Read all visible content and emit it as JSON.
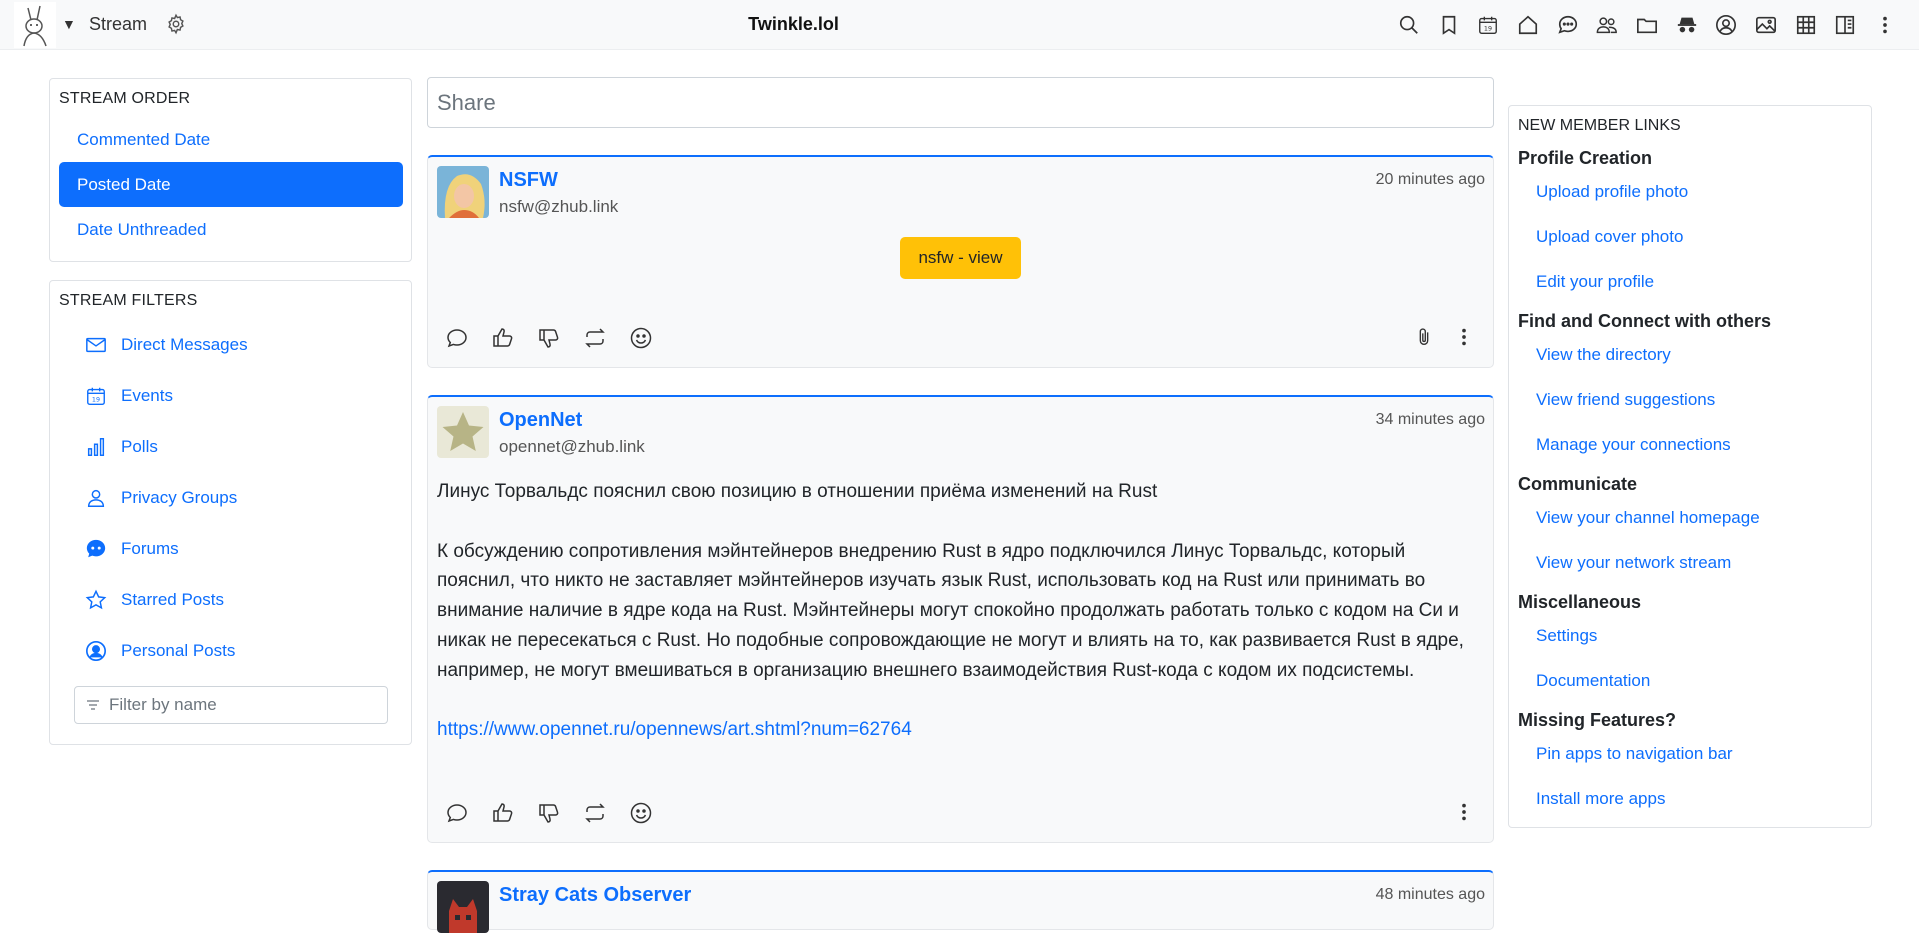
{
  "topbar": {
    "app_name": "Stream",
    "site_title": "Twinkle.lol",
    "icons": [
      "search-icon",
      "bookmark-icon",
      "calendar-icon",
      "home-icon",
      "chat-icon",
      "people-icon",
      "folder-icon",
      "incognito-icon",
      "profile-icon",
      "image-icon",
      "grid-icon",
      "book-icon",
      "more-vertical-icon"
    ]
  },
  "stream_order": {
    "title": "STREAM ORDER",
    "items": [
      {
        "label": "Commented Date",
        "active": false
      },
      {
        "label": "Posted Date",
        "active": true
      },
      {
        "label": "Date Unthreaded",
        "active": false
      }
    ]
  },
  "stream_filters": {
    "title": "STREAM FILTERS",
    "items": [
      {
        "label": "Direct Messages",
        "icon": "envelope-icon"
      },
      {
        "label": "Events",
        "icon": "calendar-icon"
      },
      {
        "label": "Polls",
        "icon": "bar-chart-icon"
      },
      {
        "label": "Privacy Groups",
        "icon": "person-icon"
      },
      {
        "label": "Forums",
        "icon": "forum-icon"
      },
      {
        "label": "Starred Posts",
        "icon": "star-icon"
      },
      {
        "label": "Personal Posts",
        "icon": "person-circle-icon"
      }
    ],
    "filter_placeholder": "Filter by name"
  },
  "share": {
    "placeholder": "Share"
  },
  "posts": [
    {
      "author": "NSFW",
      "handle": "nsfw@zhub.link",
      "time": "20 minutes ago",
      "nsfw_button": "nsfw - view"
    },
    {
      "author": "OpenNet",
      "handle": "opennet@zhub.link",
      "time": "34 minutes ago",
      "title": "Линус Торвальдс пояснил свою позицию в отношении приёма изменений на Rust",
      "body": "К обсуждению сопротивления мэйнтейнеров внедрению Rust в ядро подключился Линус Торвальдс, который пояснил, что никто не заставляет мэйнтейнеров изучать язык Rust, использовать код на Rust или принимать во внимание наличие в ядре кода на Rust. Мэйнтейнеры могут спокойно продолжать работать только с кодом на Си и никак не пересекаться с Rust. Но подобные сопровождающие не могут и влиять на то, как развивается Rust в ядре, например, не могут вмешиваться в организацию внешнего взаимодействия Rust-кода с кодом их подсистемы.",
      "link": "https://www.opennet.ru/opennews/art.shtml?num=62764"
    },
    {
      "author": "Stray Cats Observer",
      "time": "48 minutes ago"
    }
  ],
  "new_member": {
    "title": "NEW MEMBER LINKS",
    "sections": [
      {
        "heading": "Profile Creation",
        "links": [
          "Upload profile photo",
          "Upload cover photo",
          "Edit your profile"
        ]
      },
      {
        "heading": "Find and Connect with others",
        "links": [
          "View the directory",
          "View friend suggestions",
          "Manage your connections"
        ]
      },
      {
        "heading": "Communicate",
        "links": [
          "View your channel homepage",
          "View your network stream"
        ]
      },
      {
        "heading": "Miscellaneous",
        "links": [
          "Settings",
          "Documentation"
        ]
      },
      {
        "heading": "Missing Features?",
        "links": [
          "Pin apps to navigation bar",
          "Install more apps"
        ]
      }
    ]
  },
  "colors": {
    "accent": "#0d6efd",
    "nsfw_button": "#ffc107"
  }
}
